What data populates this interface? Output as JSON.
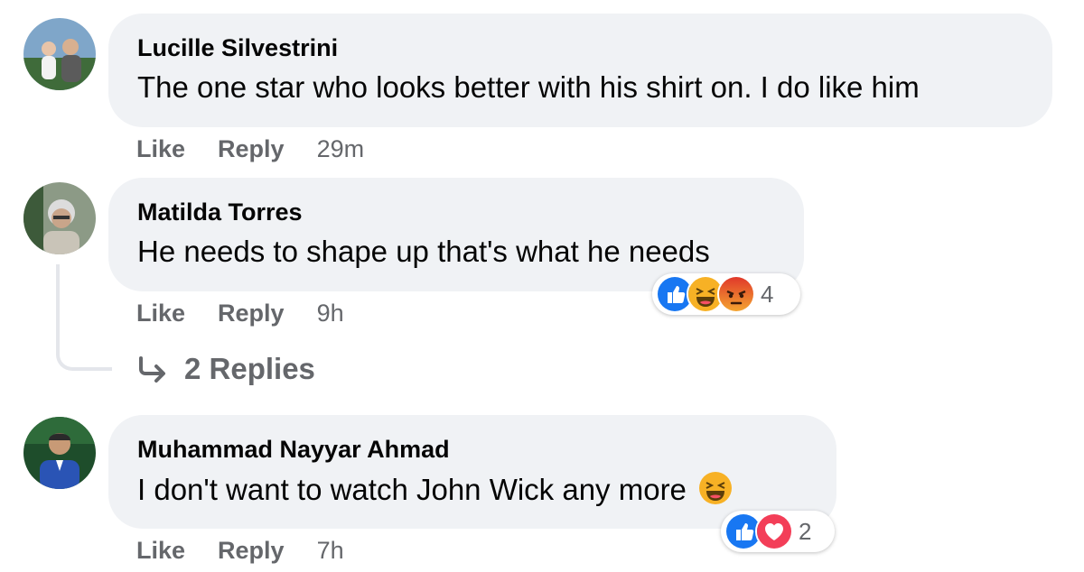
{
  "comments": [
    {
      "author": "Lucille Silvestrini",
      "text": "The one star who looks better with his shirt on. I do like him",
      "like_label": "Like",
      "reply_label": "Reply",
      "time": "29m"
    },
    {
      "author": "Matilda Torres",
      "text": "He needs to shape up that's what he needs",
      "like_label": "Like",
      "reply_label": "Reply",
      "time": "9h",
      "reaction_icons": [
        "like-icon",
        "haha-icon",
        "angry-icon"
      ],
      "reaction_count": "4",
      "replies_label": "2 Replies"
    },
    {
      "author": "Muhammad Nayyar Ahmad",
      "text": "I don't want to watch John Wick any more",
      "text_emoji": "laughing-face-emoji",
      "like_label": "Like",
      "reply_label": "Reply",
      "time": "7h",
      "reaction_icons": [
        "like-icon",
        "love-icon"
      ],
      "reaction_count": "2"
    }
  ],
  "colors": {
    "bubble": "#f0f2f5",
    "secondary_text": "#65676b",
    "like_blue": "#1877f2",
    "love_red": "#f33e58",
    "haha_yellow": "#f7b125",
    "angry_orange": "#e9710f"
  }
}
